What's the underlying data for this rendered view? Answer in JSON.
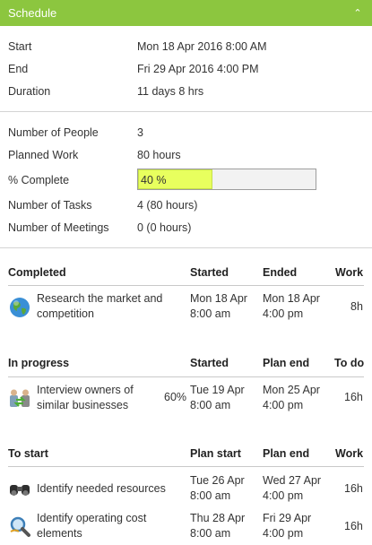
{
  "header": {
    "title": "Schedule"
  },
  "dates": {
    "start_label": "Start",
    "start_value": "Mon 18 Apr 2016 8:00 AM",
    "end_label": "End",
    "end_value": "Fri 29 Apr 2016 4:00 PM",
    "duration_label": "Duration",
    "duration_value": "11 days 8 hrs"
  },
  "stats": {
    "people_label": "Number of People",
    "people_value": "3",
    "work_label": "Planned Work",
    "work_value": "80 hours",
    "complete_label": "% Complete",
    "complete_value": "40 %",
    "complete_fraction": 0.42,
    "tasks_label": "Number of Tasks",
    "tasks_value": "4  (80 hours)",
    "meetings_label": "Number of Meetings",
    "meetings_value": "0  (0 hours)"
  },
  "completed": {
    "headers": [
      "Completed",
      "Started",
      "Ended",
      "Work"
    ],
    "rows": [
      {
        "name_line1": "Research the market and",
        "name_line2": "competition",
        "start1": "Mon 18 Apr",
        "start2": "8:00 am",
        "end1": "Mon 18 Apr",
        "end2": "4:00 pm",
        "work": "8h",
        "icon": "globe-icon"
      }
    ]
  },
  "in_progress": {
    "headers": [
      "In progress",
      "Started",
      "Plan end",
      "To do"
    ],
    "rows": [
      {
        "name_line1": "Interview owners of",
        "name_line2": "similar businesses",
        "pct": "60%",
        "start1": "Tue 19 Apr",
        "start2": "8:00 am",
        "end1": "Mon 25 Apr",
        "end2": "4:00 pm",
        "work": "16h",
        "icon": "people-exchange-icon"
      }
    ]
  },
  "to_start": {
    "headers": [
      "To start",
      "Plan start",
      "Plan end",
      "Work"
    ],
    "rows": [
      {
        "name_line1": "Identify needed resources",
        "name_line2": "",
        "start1": "Tue 26 Apr",
        "start2": "8:00 am",
        "end1": "Wed 27 Apr",
        "end2": "4:00 pm",
        "work": "16h",
        "icon": "binoculars-icon"
      },
      {
        "name_line1": "Identify operating cost",
        "name_line2": "elements",
        "start1": "Thu 28 Apr",
        "start2": "8:00 am",
        "end1": "Fri 29 Apr",
        "end2": "4:00 pm",
        "work": "16h",
        "icon": "magnifier-icon"
      }
    ]
  }
}
